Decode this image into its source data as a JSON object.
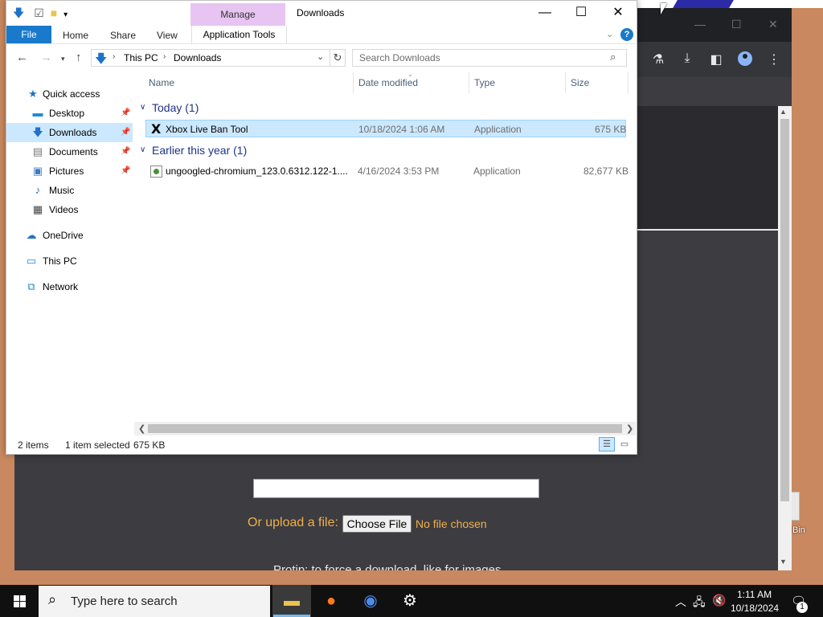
{
  "explorer": {
    "title": "Downloads",
    "ribbon": {
      "context_tab": "Manage",
      "tabs": [
        "File",
        "Home",
        "Share",
        "View"
      ],
      "context_subtab": "Application Tools",
      "help": "?"
    },
    "address": {
      "crumbs": [
        "This PC",
        "Downloads"
      ],
      "search_placeholder": "Search Downloads"
    },
    "nav": {
      "items": [
        {
          "label": "Quick access",
          "icon": "star-icon"
        },
        {
          "label": "Desktop",
          "icon": "desktop-icon",
          "pinned": true
        },
        {
          "label": "Downloads",
          "icon": "download-icon",
          "pinned": true,
          "selected": true
        },
        {
          "label": "Documents",
          "icon": "documents-icon",
          "pinned": true
        },
        {
          "label": "Pictures",
          "icon": "pictures-icon",
          "pinned": true
        },
        {
          "label": "Music",
          "icon": "music-icon"
        },
        {
          "label": "Videos",
          "icon": "videos-icon"
        },
        {
          "label": "OneDrive",
          "icon": "cloud-icon"
        },
        {
          "label": "This PC",
          "icon": "computer-icon"
        },
        {
          "label": "Network",
          "icon": "network-icon"
        }
      ]
    },
    "columns": [
      "Name",
      "Date modified",
      "Type",
      "Size"
    ],
    "groups": [
      {
        "label": "Today (1)",
        "files": [
          {
            "name": "Xbox Live Ban Tool",
            "date": "10/18/2024 1:06 AM",
            "type": "Application",
            "size": "675 KB",
            "selected": true
          }
        ]
      },
      {
        "label": "Earlier this year (1)",
        "files": [
          {
            "name": "ungoogled-chromium_123.0.6312.122-1....",
            "date": "4/16/2024 3:53 PM",
            "type": "Application",
            "size": "82,677 KB",
            "selected": false
          }
        ]
      }
    ],
    "status": {
      "items": "2 items",
      "selection": "1 item selected",
      "selection_size": "675 KB"
    }
  },
  "browser": {
    "upload_label": "Or upload a file:",
    "choose_file": "Choose File",
    "no_file": "No file chosen",
    "protip": "Protip: to force a download, like for images"
  },
  "desktop": {
    "recycle_label": "Bin"
  },
  "taskbar": {
    "search_placeholder": "Type here to search",
    "time": "1:11 AM",
    "date": "10/18/2024",
    "notification_count": "1"
  }
}
